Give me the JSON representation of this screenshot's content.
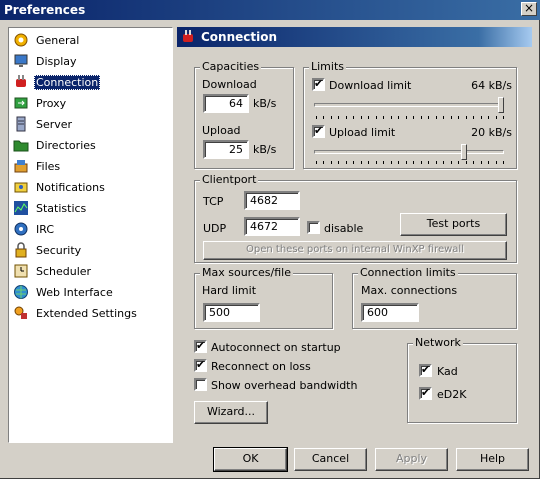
{
  "window": {
    "title": "Preferences",
    "close_glyph": "×"
  },
  "sidebar": {
    "items": [
      {
        "label": "General",
        "icon": "gear-icon"
      },
      {
        "label": "Display",
        "icon": "monitor-icon"
      },
      {
        "label": "Connection",
        "icon": "plug-icon",
        "selected": true
      },
      {
        "label": "Proxy",
        "icon": "proxy-icon"
      },
      {
        "label": "Server",
        "icon": "server-icon"
      },
      {
        "label": "Directories",
        "icon": "folder-icon"
      },
      {
        "label": "Files",
        "icon": "files-icon"
      },
      {
        "label": "Notifications",
        "icon": "bell-icon"
      },
      {
        "label": "Statistics",
        "icon": "stats-icon"
      },
      {
        "label": "IRC",
        "icon": "irc-icon"
      },
      {
        "label": "Security",
        "icon": "lock-icon"
      },
      {
        "label": "Scheduler",
        "icon": "clock-icon"
      },
      {
        "label": "Web Interface",
        "icon": "globe-icon"
      },
      {
        "label": "Extended Settings",
        "icon": "tools-icon"
      }
    ]
  },
  "panel": {
    "title": "Connection",
    "icon": "plug-icon"
  },
  "capacities": {
    "label": "Capacities",
    "download_label": "Download",
    "download_value": "64",
    "download_unit": "kB/s",
    "upload_label": "Upload",
    "upload_value": "25",
    "upload_unit": "kB/s"
  },
  "limits": {
    "label": "Limits",
    "download_limit_label": "Download limit",
    "download_limit_checked": true,
    "download_limit_value": "64 kB/s",
    "download_slider_fraction": 1.0,
    "upload_limit_label": "Upload limit",
    "upload_limit_checked": true,
    "upload_limit_value": "20 kB/s",
    "upload_slider_fraction": 0.8
  },
  "clientport": {
    "label": "Clientport",
    "tcp_label": "TCP",
    "tcp_value": "4682",
    "udp_label": "UDP",
    "udp_value": "4672",
    "disable_label": "disable",
    "disable_checked": false,
    "test_ports_label": "Test ports",
    "firewall_label": "Open these ports on internal WinXP firewall"
  },
  "max_sources": {
    "label": "Max sources/file",
    "hard_limit_label": "Hard limit",
    "hard_limit_value": "500"
  },
  "connection_limits": {
    "label": "Connection limits",
    "max_connections_label": "Max. connections",
    "max_connections_value": "600"
  },
  "options": {
    "autoconnect_label": "Autoconnect on startup",
    "autoconnect_checked": true,
    "reconnect_label": "Reconnect on loss",
    "reconnect_checked": true,
    "overhead_label": "Show overhead bandwidth",
    "overhead_checked": false,
    "wizard_label": "Wizard..."
  },
  "network": {
    "label": "Network",
    "kad_label": "Kad",
    "kad_checked": true,
    "ed2k_label": "eD2K",
    "ed2k_checked": true
  },
  "buttons": {
    "ok": "OK",
    "cancel": "Cancel",
    "apply": "Apply",
    "help": "Help"
  },
  "check_glyph": "✔"
}
